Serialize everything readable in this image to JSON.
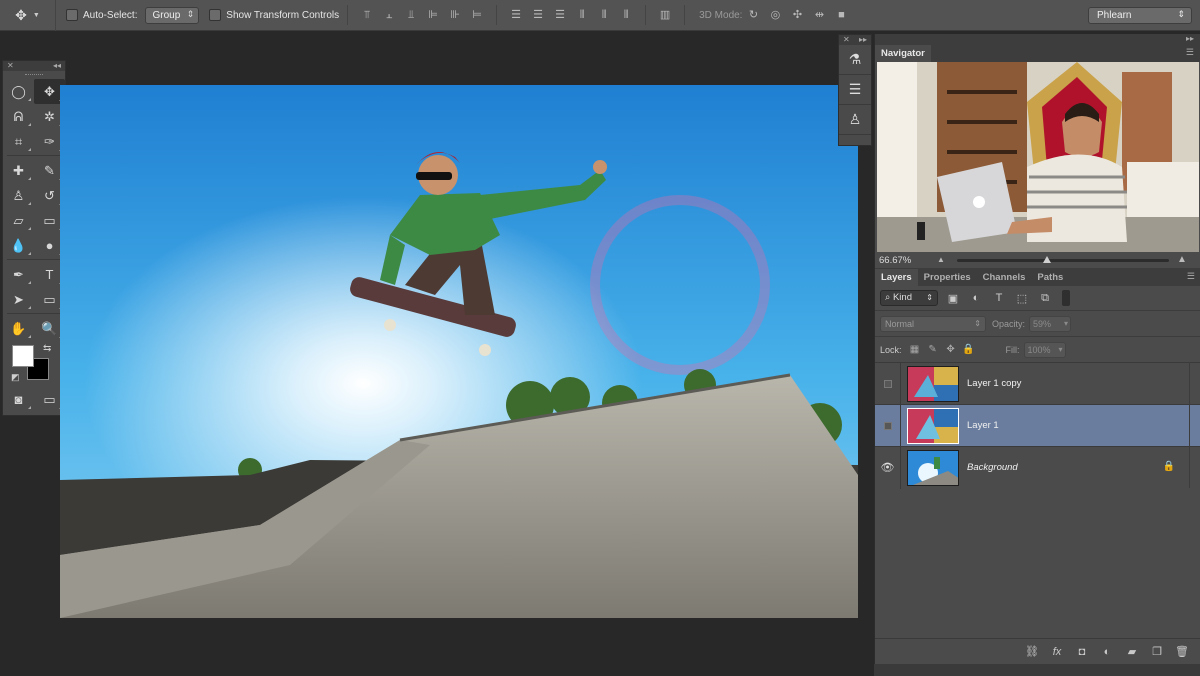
{
  "options_bar": {
    "tool_icon": "move-tool-icon",
    "auto_select_label": "Auto-Select:",
    "auto_select_mode": "Group",
    "show_transform_label": "Show Transform Controls",
    "mode_3d_label": "3D Mode:",
    "workspace": "Phlearn"
  },
  "navigator": {
    "tab": "Navigator",
    "zoom": "66.67%"
  },
  "layers_panel": {
    "tabs": [
      "Layers",
      "Properties",
      "Channels",
      "Paths"
    ],
    "filter_kind": "Kind",
    "blend_mode": "Normal",
    "opacity_label": "Opacity:",
    "opacity_value": "59%",
    "lock_label": "Lock:",
    "fill_label": "Fill:",
    "fill_value": "100%",
    "layers": [
      {
        "name": "Layer 1 copy",
        "visible": false,
        "selected": false,
        "locked": false
      },
      {
        "name": "Layer 1",
        "visible": false,
        "selected": true,
        "locked": false
      },
      {
        "name": "Background",
        "visible": true,
        "selected": false,
        "locked": true
      }
    ]
  },
  "colors": {
    "foreground": "#ffffff",
    "background": "#000000",
    "selection": "#6a7d9e"
  }
}
